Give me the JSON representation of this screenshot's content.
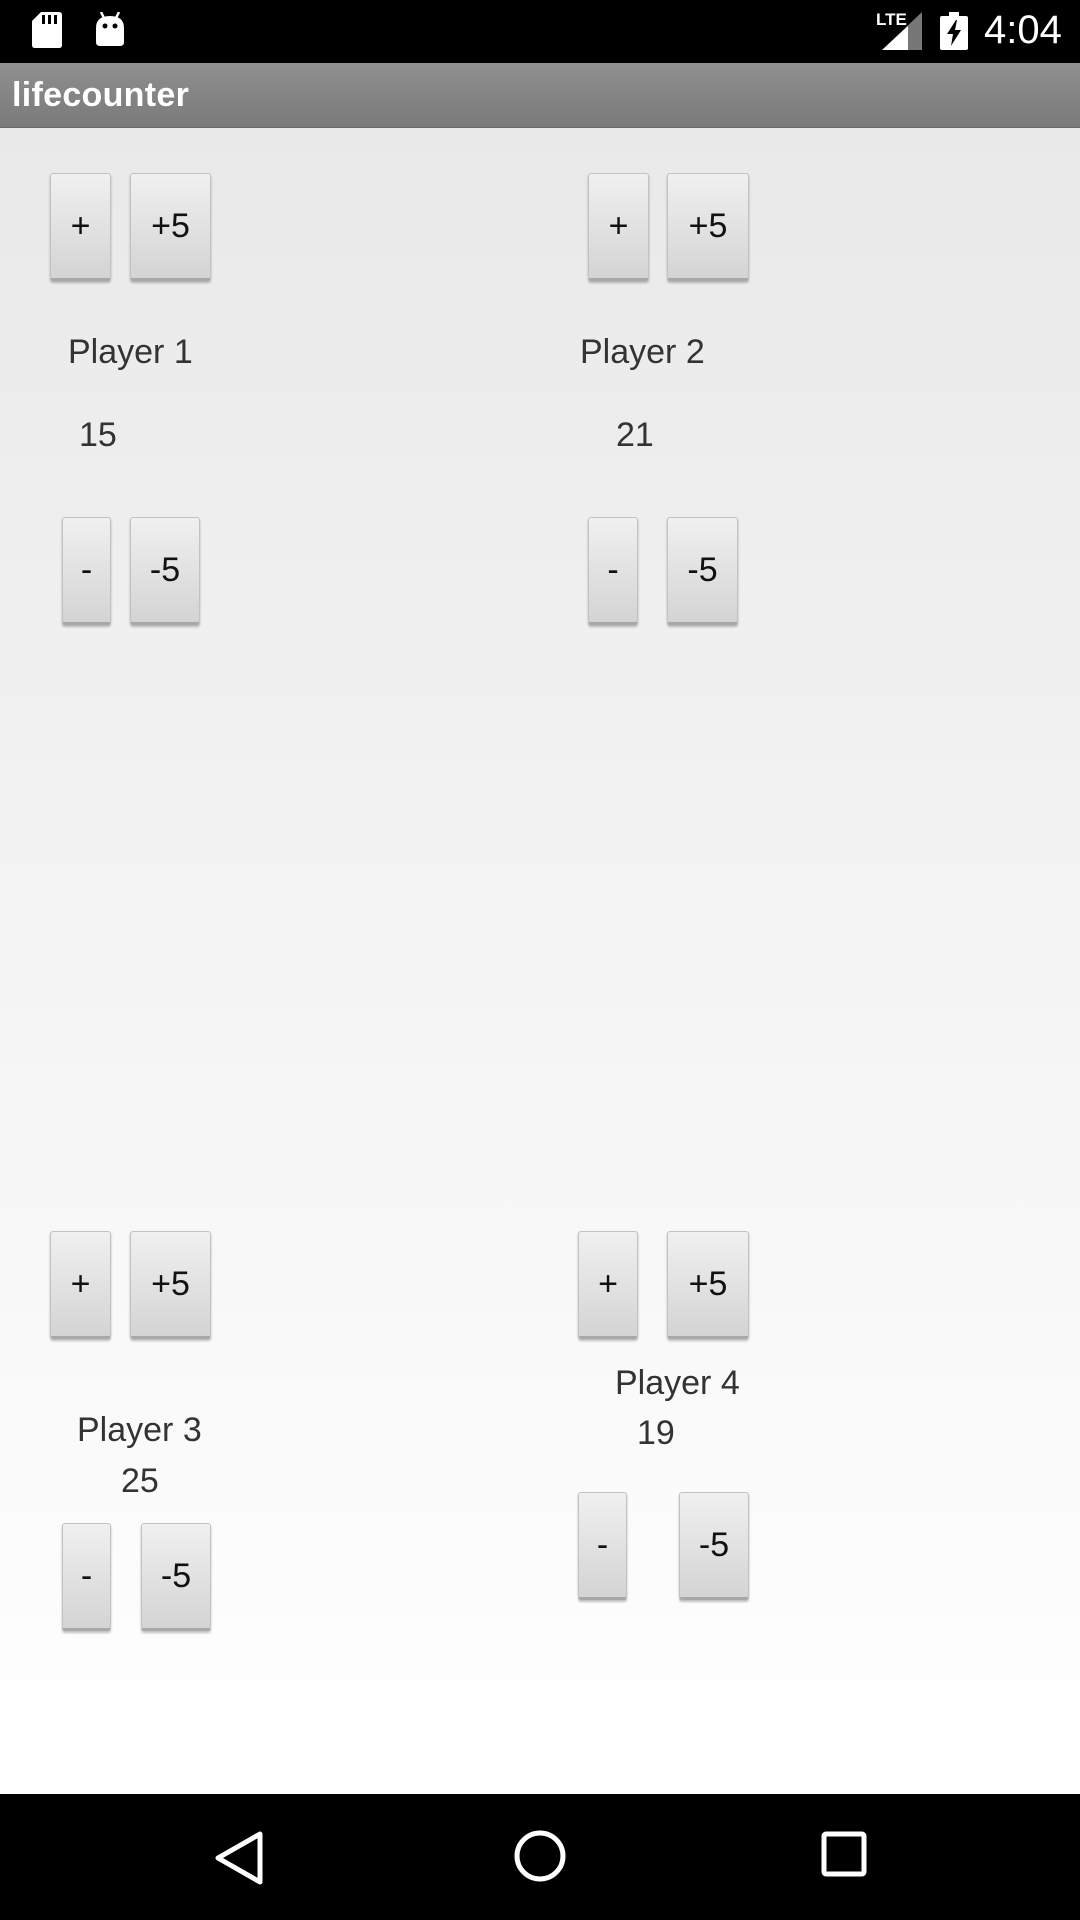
{
  "status_bar": {
    "time": "4:04",
    "network": "LTE",
    "icons": [
      "sd-card-icon",
      "android-debug-icon",
      "signal-icon",
      "battery-charging-icon"
    ]
  },
  "app": {
    "title": "lifecounter"
  },
  "players": [
    {
      "name": "Player 1",
      "life": "15",
      "plus_label": "+",
      "plus5_label": "+5",
      "minus_label": "-",
      "minus5_label": "-5"
    },
    {
      "name": "Player 2",
      "life": "21",
      "plus_label": "+",
      "plus5_label": "+5",
      "minus_label": "-",
      "minus5_label": "-5"
    },
    {
      "name": "Player 3",
      "life": "25",
      "plus_label": "+",
      "plus5_label": "+5",
      "minus_label": "-",
      "minus5_label": "-5"
    },
    {
      "name": "Player 4",
      "life": "19",
      "plus_label": "+",
      "plus5_label": "+5",
      "minus_label": "-",
      "minus5_label": "-5"
    }
  ],
  "nav_bar": {
    "icons": [
      "back-icon",
      "home-icon",
      "recents-icon"
    ]
  },
  "colors": {
    "action_bar": "#858585",
    "background": "#f0f0f0",
    "button": "#e2e2e2"
  }
}
